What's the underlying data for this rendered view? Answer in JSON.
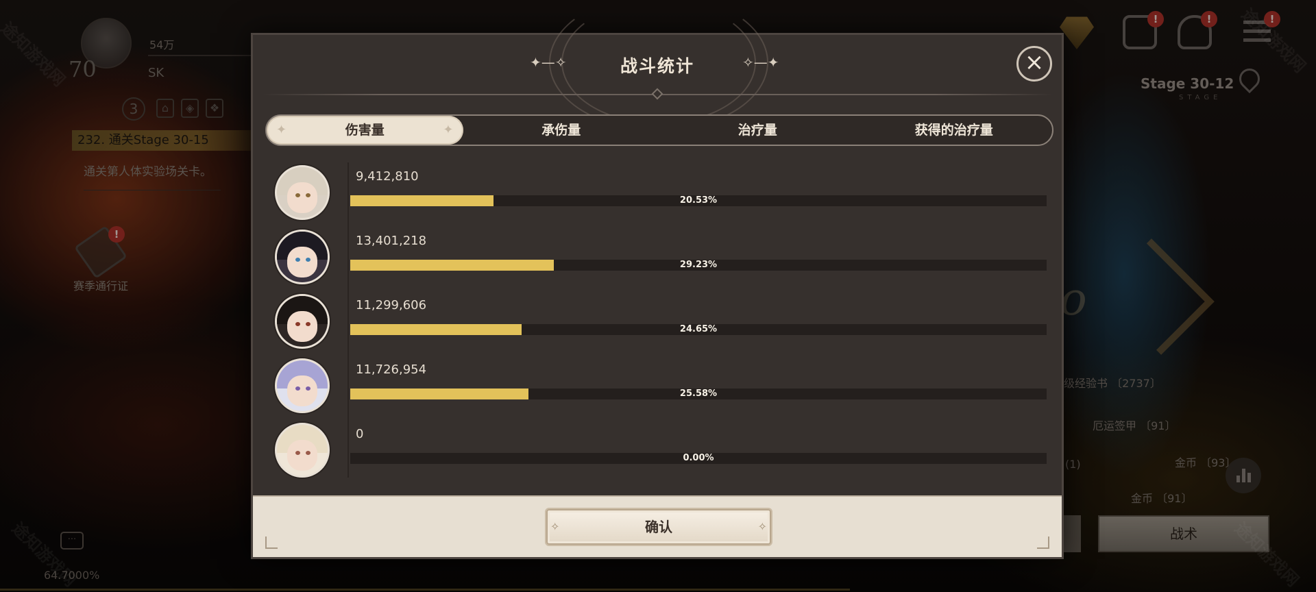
{
  "background": {
    "player": {
      "level": "70",
      "power": "54万",
      "name": "SK",
      "rank": "3"
    },
    "quest": {
      "title": "232. 通关Stage 30-15",
      "description": "通关第人体实验场关卡。"
    },
    "season_pass": {
      "label": "赛季通行证",
      "badge": "!"
    },
    "badges": [
      "!",
      "!",
      "!"
    ],
    "stage": {
      "label": "Stage 30-12",
      "sub": "STAGE"
    },
    "loot": [
      {
        "label": "级经验书",
        "count": "〔2737〕"
      },
      {
        "label": "厄运签甲",
        "count": "〔91〕"
      },
      {
        "label": "金币",
        "count": "〔93〕"
      },
      {
        "label": "金币",
        "count": "〔91〕"
      },
      {
        "label": "",
        "count": "(1)"
      }
    ],
    "tactic_button": "战术",
    "progress_percent": "64.7000%",
    "watermark": "途知游戏网"
  },
  "modal": {
    "title": "战斗统计",
    "tabs": [
      {
        "label": "伤害量",
        "active": true
      },
      {
        "label": "承伤量",
        "active": false
      },
      {
        "label": "治疗量",
        "active": false
      },
      {
        "label": "获得的治疗量",
        "active": false
      }
    ],
    "rows": [
      {
        "value": "9,412,810",
        "percent": "20.53%",
        "fraction": 0.2053
      },
      {
        "value": "13,401,218",
        "percent": "29.23%",
        "fraction": 0.2923
      },
      {
        "value": "11,299,606",
        "percent": "24.65%",
        "fraction": 0.2465
      },
      {
        "value": "11,726,954",
        "percent": "25.58%",
        "fraction": 0.2558
      },
      {
        "value": "0",
        "percent": "0.00%",
        "fraction": 0
      }
    ],
    "confirm_label": "确认",
    "colors": {
      "bar": "#e3c25a",
      "panel": "#36302d",
      "footer": "#e7dfd2"
    }
  }
}
